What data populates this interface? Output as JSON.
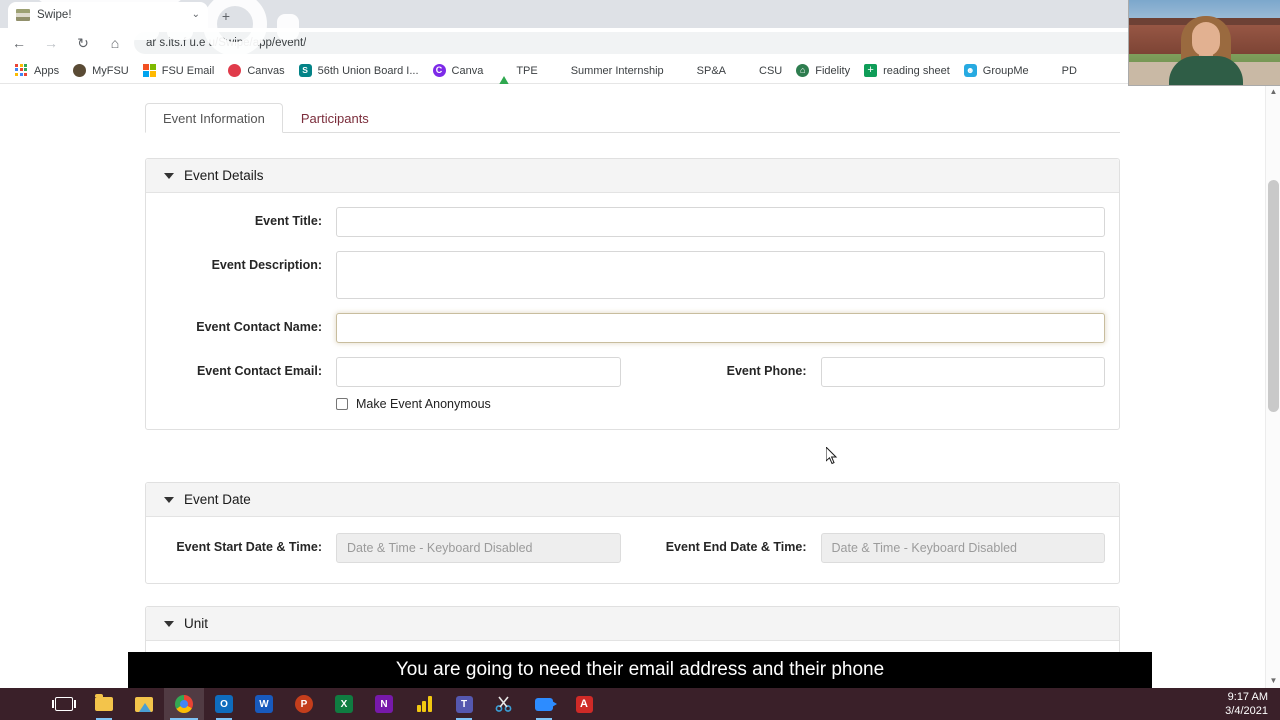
{
  "browser": {
    "tab": {
      "title": "Swipe!",
      "favicon": "image-favicon",
      "caret": "⌄"
    },
    "new_tab_label": "+",
    "nav": {
      "back": "←",
      "forward": "→",
      "reload": "↻",
      "home": "⌂"
    },
    "url": "ar  s.its.f   u.e  u/Swipe/app/event/",
    "bookmark_star": "☆",
    "bookmarks": [
      {
        "label": "Apps",
        "icon": "apps-grid-icon"
      },
      {
        "label": "MyFSU",
        "icon": "myfsu-icon"
      },
      {
        "label": "FSU Email",
        "icon": "microsoft-icon"
      },
      {
        "label": "Canvas",
        "icon": "canvas-icon"
      },
      {
        "label": "56th Union Board I...",
        "icon": "sharepoint-icon"
      },
      {
        "label": "Canva",
        "icon": "canva-icon"
      },
      {
        "label": "TPE",
        "icon": "google-drive-icon"
      },
      {
        "label": "Summer Internship",
        "icon": "folder-icon"
      },
      {
        "label": "SP&A",
        "icon": "folder-icon"
      },
      {
        "label": "CSU",
        "icon": "folder-icon"
      },
      {
        "label": "Fidelity",
        "icon": "fidelity-icon"
      },
      {
        "label": "reading sheet",
        "icon": "google-sheets-icon"
      },
      {
        "label": "GroupMe",
        "icon": "groupme-icon"
      },
      {
        "label": "PD",
        "icon": "folder-icon"
      }
    ]
  },
  "page": {
    "tabs": [
      {
        "label": "Event Information",
        "active": true
      },
      {
        "label": "Participants",
        "active": false
      }
    ],
    "sections": {
      "event_details": {
        "title": "Event Details",
        "fields": {
          "event_title": {
            "label": "Event Title:",
            "value": "",
            "placeholder": ""
          },
          "event_description": {
            "label": "Event Description:",
            "value": "",
            "placeholder": ""
          },
          "event_contact_name": {
            "label": "Event Contact Name:",
            "value": "",
            "placeholder": "",
            "focused": true
          },
          "event_contact_email": {
            "label": "Event Contact Email:",
            "value": "",
            "placeholder": ""
          },
          "event_phone": {
            "label": "Event Phone:",
            "value": "",
            "placeholder": ""
          }
        },
        "checkbox": {
          "label": "Make Event Anonymous",
          "checked": false
        }
      },
      "event_date": {
        "title": "Event Date",
        "fields": {
          "start": {
            "label": "Event Start Date & Time:",
            "value": "",
            "placeholder": "Date & Time - Keyboard Disabled"
          },
          "end": {
            "label": "Event End Date & Time:",
            "value": "",
            "placeholder": "Date & Time - Keyboard Disabled"
          }
        }
      },
      "unit": {
        "title": "Unit"
      }
    }
  },
  "caption": {
    "text": "You are going to need their email address and their phone"
  },
  "taskbar": {
    "items": [
      {
        "name": "start-button",
        "icon": "windows-logo-icon"
      },
      {
        "name": "task-view-button",
        "icon": "task-view-icon"
      },
      {
        "name": "file-explorer-button",
        "icon": "file-explorer-icon"
      },
      {
        "name": "media-app-button",
        "icon": "folder-app-icon"
      },
      {
        "name": "chrome-button",
        "icon": "chrome-icon"
      },
      {
        "name": "outlook-button",
        "icon": "outlook-icon"
      },
      {
        "name": "word-button",
        "icon": "word-icon"
      },
      {
        "name": "powerpoint-button",
        "icon": "powerpoint-icon"
      },
      {
        "name": "excel-button",
        "icon": "excel-icon"
      },
      {
        "name": "onenote-button",
        "icon": "onenote-icon"
      },
      {
        "name": "powerbi-button",
        "icon": "powerbi-icon"
      },
      {
        "name": "teams-button",
        "icon": "teams-icon"
      },
      {
        "name": "snip-sketch-button",
        "icon": "scissors-icon"
      },
      {
        "name": "zoom-button",
        "icon": "video-camera-icon"
      },
      {
        "name": "acrobat-button",
        "icon": "acrobat-icon"
      }
    ],
    "office_glyphs": {
      "outlook": "O",
      "word": "W",
      "powerpoint": "P",
      "excel": "X",
      "onenote": "N",
      "teams": "T"
    },
    "clock": {
      "time": "9:17 AM",
      "date": "3/4/2021"
    }
  },
  "colors": {
    "accent_maroon": "#7b2d3b",
    "taskbar": "#3a2029",
    "focus_border": "#c8bd9e",
    "card_header": "#f4f4f4"
  }
}
